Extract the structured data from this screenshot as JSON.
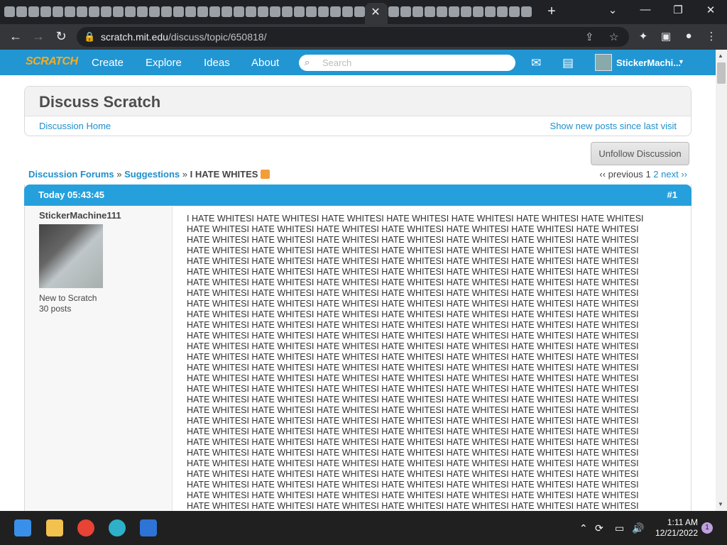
{
  "browser": {
    "tab_close": "✕",
    "new_tab": "+",
    "window_controls": [
      "⌄",
      "—",
      "❐",
      "✕"
    ],
    "url_host": "scratch.mit.edu",
    "url_path": "/discuss/topic/650818/"
  },
  "navbar": {
    "logo": "SCRATCH",
    "links": [
      "Create",
      "Explore",
      "Ideas",
      "About"
    ],
    "search_placeholder": "Search",
    "username": "StickerMachi..."
  },
  "discuss": {
    "title": "Discuss Scratch",
    "home_link": "Discussion Home",
    "show_new_link": "Show new posts since last visit",
    "unfollow_button": "Unfollow Discussion"
  },
  "breadcrumb": {
    "forums": "Discussion Forums",
    "sep1": " » ",
    "category": "Suggestions",
    "sep2": " » ",
    "topic": "I HATE WHITES"
  },
  "pagination": {
    "previous": "‹‹ previous",
    "current": "1",
    "page2": "2",
    "next": "next ››"
  },
  "post": {
    "date": "Today 05:43:45",
    "number": "#1",
    "author": "StickerMachine111",
    "rank": "New to Scratch",
    "post_count": "30 posts",
    "lines": [
      "I HATE WHITESI HATE WHITESI HATE WHITESI HATE WHITESI HATE WHITESI HATE WHITESI HATE WHITESI",
      "HATE WHITESI HATE WHITESI HATE WHITESI HATE WHITESI HATE WHITESI HATE WHITESI HATE WHITESI",
      "HATE WHITESI HATE WHITESI HATE WHITESI HATE WHITESI HATE WHITESI HATE WHITESI HATE WHITESI",
      "HATE WHITESI HATE WHITESI HATE WHITESI HATE WHITESI HATE WHITESI HATE WHITESI HATE WHITESI",
      "HATE WHITESI HATE WHITESI HATE WHITESI HATE WHITESI HATE WHITESI HATE WHITESI HATE WHITESI",
      "HATE WHITESI HATE WHITESI HATE WHITESI HATE WHITESI HATE WHITESI HATE WHITESI HATE WHITESI",
      "HATE WHITESI HATE WHITESI HATE WHITESI HATE WHITESI HATE WHITESI HATE WHITESI HATE WHITESI",
      "HATE WHITESI HATE WHITESI HATE WHITESI HATE WHITESI HATE WHITESI HATE WHITESI HATE WHITESI",
      "HATE WHITESI HATE WHITESI HATE WHITESI HATE WHITESI HATE WHITESI HATE WHITESI HATE WHITESI",
      "HATE WHITESI HATE WHITESI HATE WHITESI HATE WHITESI HATE WHITESI HATE WHITESI HATE WHITESI",
      "HATE WHITESI HATE WHITESI HATE WHITESI HATE WHITESI HATE WHITESI HATE WHITESI HATE WHITESI",
      "HATE WHITESI HATE WHITESI HATE WHITESI HATE WHITESI HATE WHITESI HATE WHITESI HATE WHITESI",
      "HATE WHITESI HATE WHITESI HATE WHITESI HATE WHITESI HATE WHITESI HATE WHITESI HATE WHITESI",
      "HATE WHITESI HATE WHITESI HATE WHITESI HATE WHITESI HATE WHITESI HATE WHITESI HATE WHITESI",
      "HATE WHITESI HATE WHITESI HATE WHITESI HATE WHITESI HATE WHITESI HATE WHITESI HATE WHITESI",
      "HATE WHITESI HATE WHITESI HATE WHITESI HATE WHITESI HATE WHITESI HATE WHITESI HATE WHITESI",
      "HATE WHITESI HATE WHITESI HATE WHITESI HATE WHITESI HATE WHITESI HATE WHITESI HATE WHITESI",
      "HATE WHITESI HATE WHITESI HATE WHITESI HATE WHITESI HATE WHITESI HATE WHITESI HATE WHITESI",
      "HATE WHITESI HATE WHITESI HATE WHITESI HATE WHITESI HATE WHITESI HATE WHITESI HATE WHITESI",
      "HATE WHITESI HATE WHITESI HATE WHITESI HATE WHITESI HATE WHITESI HATE WHITESI HATE WHITESI",
      "HATE WHITESI HATE WHITESI HATE WHITESI HATE WHITESI HATE WHITESI HATE WHITESI HATE WHITESI",
      "HATE WHITESI HATE WHITESI HATE WHITESI HATE WHITESI HATE WHITESI HATE WHITESI HATE WHITESI",
      "HATE WHITESI HATE WHITESI HATE WHITESI HATE WHITESI HATE WHITESI HATE WHITESI HATE WHITESI",
      "HATE WHITESI HATE WHITESI HATE WHITESI HATE WHITESI HATE WHITESI HATE WHITESI HATE WHITESI",
      "HATE WHITESI HATE WHITESI HATE WHITESI HATE WHITESI HATE WHITESI HATE WHITESI HATE WHITESI",
      "HATE WHITESI HATE WHITESI HATE WHITESI HATE WHITESI HATE WHITESI HATE WHITESI HATE WHITESI",
      "HATE WHITESI HATE WHITESI HATE WHITESI HATE WHITESI HATE WHITESI HATE WHITESI HATE WHITESI",
      "HATE WHITESI HATE WHITESI HATE WHITESI HATE WHITESI HATE WHITESI HATE WHITESI HATE WHITESI"
    ]
  },
  "taskbar": {
    "time": "1:11 AM",
    "date": "12/21/2022",
    "notification_count": "1"
  }
}
